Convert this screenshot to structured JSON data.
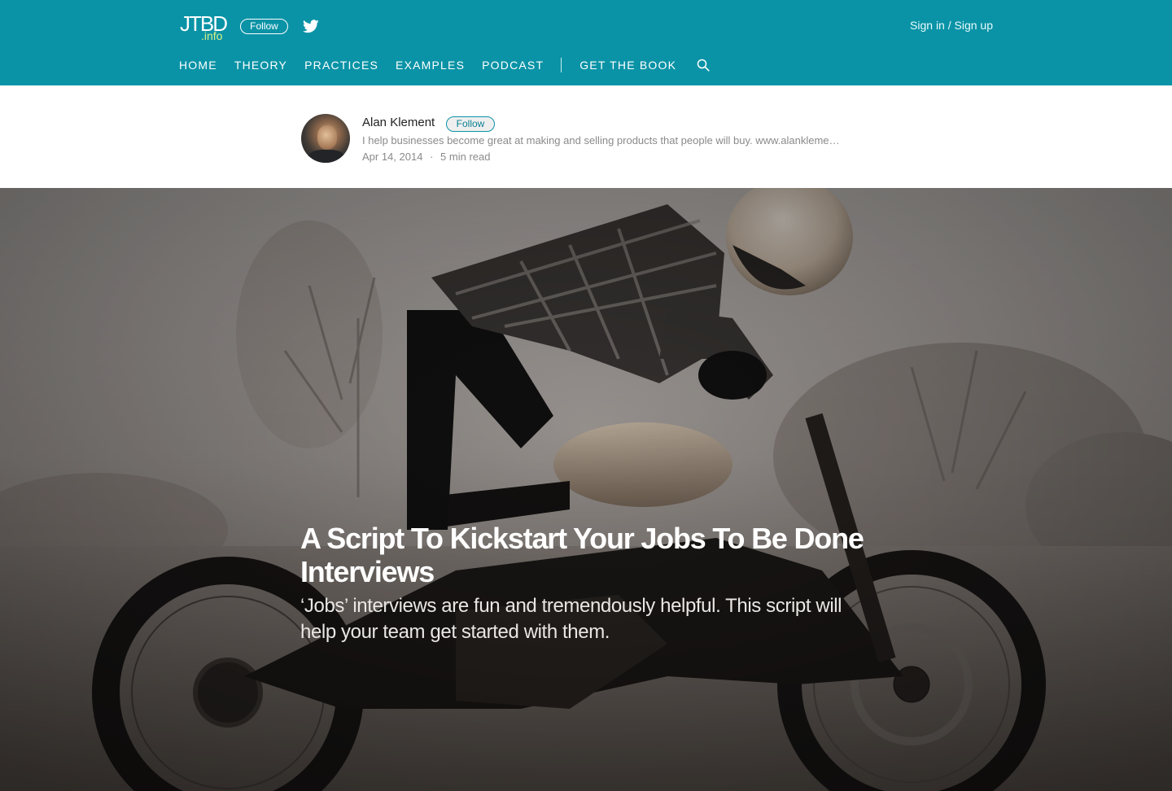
{
  "header": {
    "brand_main": "JTBD",
    "brand_sub": ".info",
    "follow_label": "Follow",
    "signin_label": "Sign in / Sign up",
    "nav": {
      "items": [
        "HOME",
        "THEORY",
        "PRACTICES",
        "EXAMPLES",
        "PODCAST"
      ],
      "book": "GET THE BOOK"
    },
    "icons": {
      "twitter": "twitter-icon",
      "search": "search-icon"
    }
  },
  "author": {
    "name": "Alan Klement",
    "follow_label": "Follow",
    "bio": "I help businesses become great at making and selling products that people will buy. www.alankleme…",
    "date": "Apr 14, 2014",
    "separator": "·",
    "read_time": "5 min read"
  },
  "article": {
    "title": "A Script To Kickstart Your Jobs To Be Done Interviews",
    "subtitle": "‘Jobs’ interviews are fun and tremendously helpful. This script will help your team get started with them."
  },
  "colors": {
    "brand_teal": "#0a93a6",
    "brand_sub": "#d7f08a",
    "muted_text": "#8a8a8a"
  }
}
